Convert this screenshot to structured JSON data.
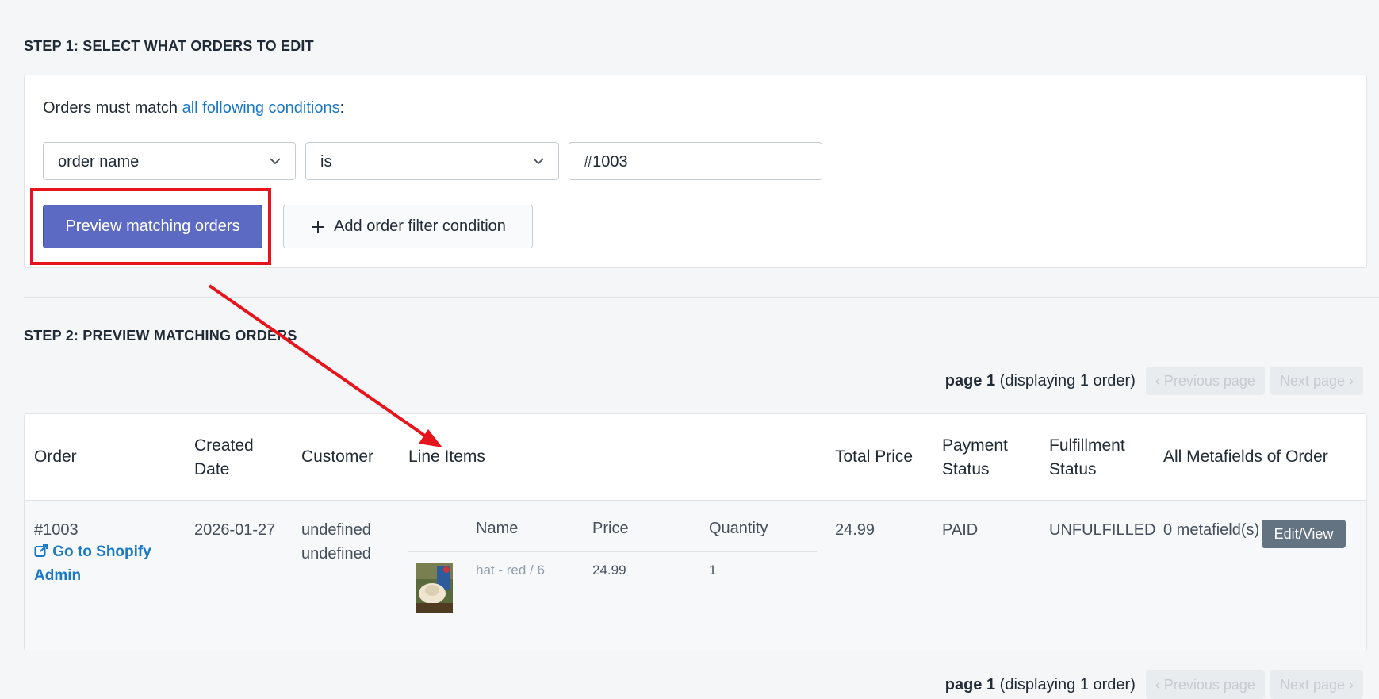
{
  "step1": {
    "title": "STEP 1: SELECT WHAT ORDERS TO EDIT",
    "match_prefix": "Orders must match ",
    "match_link": "all following conditions",
    "match_suffix": ":",
    "condition": {
      "field": "order name",
      "operator": "is",
      "value": "#1003"
    },
    "preview_button": "Preview matching orders",
    "add_filter_button": "Add order filter condition"
  },
  "step2": {
    "title": "STEP 2: PREVIEW MATCHING ORDERS",
    "pager": {
      "page": "page 1",
      "displaying": "(displaying 1 order)",
      "prev": "Previous page",
      "next": "Next page"
    },
    "table": {
      "headers": {
        "order": "Order",
        "created_1": "Created",
        "created_2": "Date",
        "customer": "Customer",
        "line_items": "Line Items",
        "total_price": "Total Price",
        "payment_1": "Payment",
        "payment_2": "Status",
        "fulfillment_1": "Fulfillment",
        "fulfillment_2": "Status",
        "metafields": "All Metafields of Order"
      },
      "row": {
        "order": "#1003",
        "shopify_link_1": "Go to Shopify",
        "shopify_link_2": "Admin",
        "created": "2026-01-27",
        "customer_1": "undefined",
        "customer_2": "undefined",
        "line_item_headers": {
          "name": "Name",
          "price": "Price",
          "quantity": "Quantity"
        },
        "line_item": {
          "name": "hat - red / 6",
          "price": "24.99",
          "quantity": "1"
        },
        "total_price": "24.99",
        "payment_status": "PAID",
        "fulfillment_status": "UNFULFILLED",
        "metafields": "0 metafield(s)",
        "edit_button": "Edit/View"
      }
    }
  },
  "colors": {
    "primary": "#5c6ac4",
    "link": "#1a79c6",
    "annotation": "#e8141b"
  }
}
